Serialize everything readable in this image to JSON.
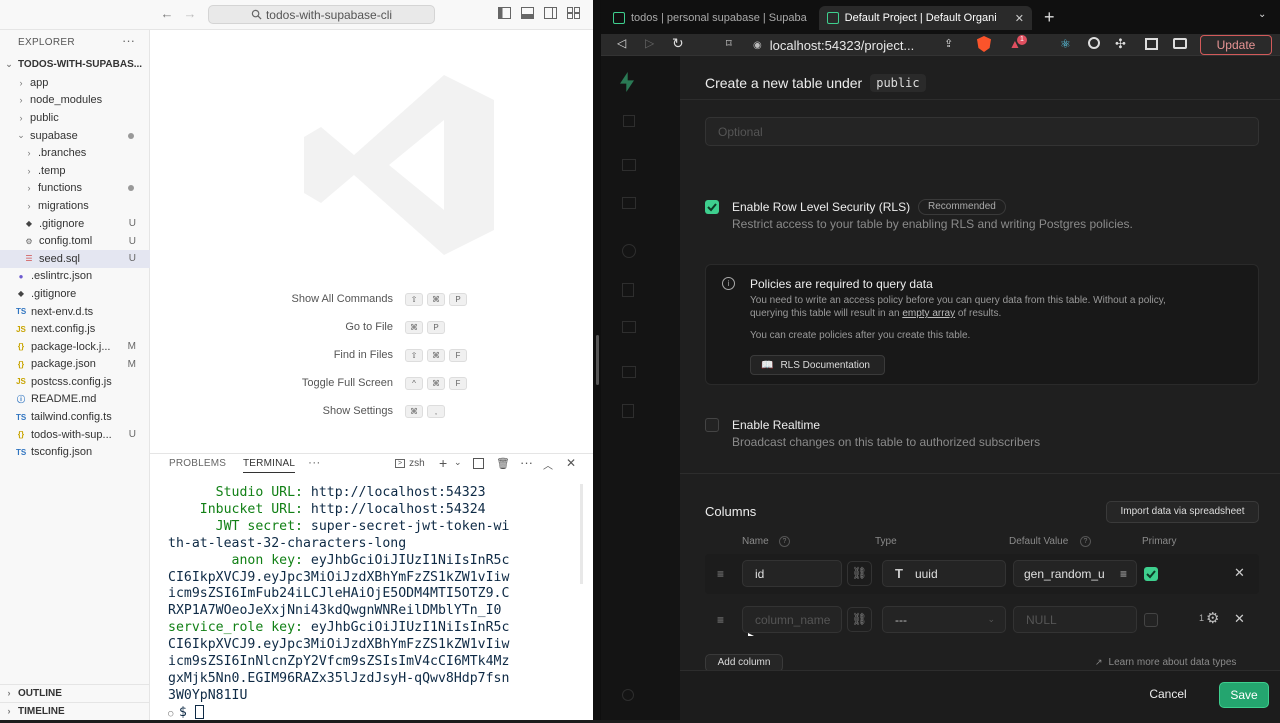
{
  "vscode": {
    "search": "todos-with-supabase-cli",
    "explorer": "EXPLORER",
    "root": "TODOS-WITH-SUPABAS...",
    "tree": [
      {
        "label": "app",
        "kind": "folder",
        "depth": 1,
        "open": false
      },
      {
        "label": "node_modules",
        "kind": "folder",
        "depth": 1,
        "open": false
      },
      {
        "label": "public",
        "kind": "folder",
        "depth": 1,
        "open": false
      },
      {
        "label": "supabase",
        "kind": "folder",
        "depth": 1,
        "open": true,
        "dot": true
      },
      {
        "label": ".branches",
        "kind": "folder",
        "depth": 2,
        "open": false
      },
      {
        "label": ".temp",
        "kind": "folder",
        "depth": 2,
        "open": false
      },
      {
        "label": "functions",
        "kind": "folder",
        "depth": 2,
        "open": false,
        "dot": true
      },
      {
        "label": "migrations",
        "kind": "folder",
        "depth": 2,
        "open": false
      },
      {
        "label": ".gitignore",
        "kind": "git",
        "depth": 2,
        "badge": "U"
      },
      {
        "label": "config.toml",
        "kind": "gear",
        "depth": 2,
        "badge": "U"
      },
      {
        "label": "seed.sql",
        "kind": "db",
        "depth": 2,
        "badge": "U",
        "selected": true
      },
      {
        "label": ".eslintrc.json",
        "kind": "eslint",
        "depth": 1
      },
      {
        "label": ".gitignore",
        "kind": "git",
        "depth": 1
      },
      {
        "label": "next-env.d.ts",
        "kind": "ts",
        "depth": 1
      },
      {
        "label": "next.config.js",
        "kind": "js",
        "depth": 1
      },
      {
        "label": "package-lock.j...",
        "kind": "json",
        "depth": 1,
        "badge": "M"
      },
      {
        "label": "package.json",
        "kind": "json",
        "depth": 1,
        "badge": "M"
      },
      {
        "label": "postcss.config.js",
        "kind": "js",
        "depth": 1
      },
      {
        "label": "README.md",
        "kind": "info",
        "depth": 1
      },
      {
        "label": "tailwind.config.ts",
        "kind": "ts",
        "depth": 1
      },
      {
        "label": "todos-with-sup...",
        "kind": "json",
        "depth": 1,
        "badge": "U"
      },
      {
        "label": "tsconfig.json",
        "kind": "tsjson",
        "depth": 1
      }
    ],
    "outline": "OUTLINE",
    "timeline": "TIMELINE",
    "shortcuts": [
      {
        "label": "Show All Commands",
        "keys": [
          "⇧",
          "⌘",
          "P"
        ]
      },
      {
        "label": "Go to File",
        "keys": [
          "⌘",
          "P"
        ]
      },
      {
        "label": "Find in Files",
        "keys": [
          "⇧",
          "⌘",
          "F"
        ]
      },
      {
        "label": "Toggle Full Screen",
        "keys": [
          "^",
          "⌘",
          "F"
        ]
      },
      {
        "label": "Show Settings",
        "keys": [
          "⌘",
          ","
        ]
      }
    ],
    "panel": {
      "problems": "PROBLEMS",
      "terminal": "TERMINAL",
      "shell": "zsh",
      "lines": [
        {
          "t": "      Studio URL: http://localhost:54323",
          "g": true
        },
        {
          "t": "    Inbucket URL: http://localhost:54324",
          "g": true
        },
        {
          "t": "      JWT secret: super-secret-jwt-token-wi",
          "g": true
        },
        {
          "t": "th-at-least-32-characters-long",
          "g": false
        },
        {
          "t": "        anon key: eyJhbGciOiJIUzI1NiIsInR5c",
          "g": true
        },
        {
          "t": "CI6IkpXVCJ9.eyJpc3MiOiJzdXBhYmFzZS1kZW1vIiw",
          "g": false
        },
        {
          "t": "icm9sZSI6ImFub24iLCJleHAiOjE5ODM4MTI5OTZ9.C",
          "g": false
        },
        {
          "t": "RXP1A7WOeoJeXxjNni43kdQwgnWNReilDMblYTn_I0",
          "g": false
        },
        {
          "t": "service_role key: eyJhbGciOiJIUzI1NiIsInR5c",
          "g": true
        },
        {
          "t": "CI6IkpXVCJ9.eyJpc3MiOiJzdXBhYmFzZS1kZW1vIiw",
          "g": false
        },
        {
          "t": "icm9sZSI6InNlcnZpY2Vfcm9sZSIsImV4cCI6MTk4Mz",
          "g": false
        },
        {
          "t": "gxMjk5Nn0.EGIM96RAZx35lJzdJsyH-qQwv8Hdp7fsn",
          "g": false
        },
        {
          "t": "3W0YpN81IU",
          "g": false
        }
      ],
      "prompt": "$"
    }
  },
  "browser": {
    "tabs": [
      "todos | personal supabase | Supaba",
      "Default Project | Default Organi"
    ],
    "url": "localhost:54323/project...",
    "update": "Update",
    "notif_count": "1"
  },
  "supabase": {
    "header": "Create a new table under",
    "schema": "public",
    "desc_placeholder": "Optional",
    "rls": {
      "label": "Enable Row Level Security (RLS)",
      "badge": "Recommended",
      "desc": "Restrict access to your table by enabling RLS and writing Postgres policies."
    },
    "policies": {
      "title": "Policies are required to query data",
      "body1": "You need to write an access policy before you can query data from this table. Without a policy,",
      "body2a": "querying this table will result in an ",
      "body2link": "empty array",
      "body2b": " of results.",
      "body3": "You can create policies after you create this table.",
      "doc_btn": "RLS Documentation"
    },
    "realtime": {
      "label": "Enable Realtime",
      "desc": "Broadcast changes on this table to authorized subscribers"
    },
    "columns_title": "Columns",
    "import_btn": "Import data via spreadsheet",
    "col_headers": [
      "Name",
      "Type",
      "Default Value",
      "Primary"
    ],
    "row1": {
      "name": "id",
      "type": "uuid",
      "default": "gen_random_u"
    },
    "row2": {
      "name_ph": "column_name",
      "type": "---",
      "default_ph": "NULL",
      "count": "1"
    },
    "add_column": "Add column",
    "learn_more": "Learn more about data types",
    "cancel": "Cancel",
    "save": "Save",
    "colors": {
      "accent": "#3ecf8e",
      "bg": "#1f1f1f"
    }
  }
}
